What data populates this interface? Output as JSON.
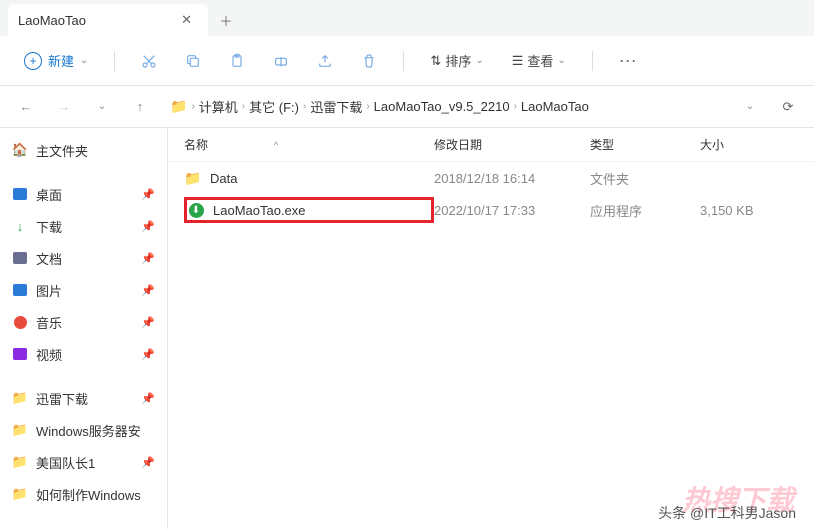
{
  "tab": {
    "title": "LaoMaoTao"
  },
  "toolbar": {
    "new_label": "新建",
    "sort_label": "排序",
    "view_label": "查看"
  },
  "breadcrumb": {
    "items": [
      "计算机",
      "其它 (F:)",
      "迅雷下载",
      "LaoMaoTao_v9.5_2210",
      "LaoMaoTao"
    ]
  },
  "sidebar": {
    "home_label": "主文件夹",
    "items": [
      {
        "label": "桌面",
        "color": "#2b7bd6"
      },
      {
        "label": "下载",
        "color": "#28a745",
        "arrow": true
      },
      {
        "label": "文档",
        "color": "#6a6f91"
      },
      {
        "label": "图片",
        "color": "#2b7bd6"
      },
      {
        "label": "音乐",
        "color": "#e84b3c",
        "circle": true
      },
      {
        "label": "视频",
        "color": "#8a2be2"
      }
    ],
    "folders": [
      {
        "label": "迅雷下载"
      },
      {
        "label": "Windows服务器安"
      },
      {
        "label": "美国队长1"
      },
      {
        "label": "如何制作Windows"
      }
    ]
  },
  "columns": {
    "name": "名称",
    "date": "修改日期",
    "type": "类型",
    "size": "大小"
  },
  "files": [
    {
      "name": "Data",
      "date": "2018/12/18 16:14",
      "type": "文件夹",
      "size": "",
      "icon": "folder"
    },
    {
      "name": "LaoMaoTao.exe",
      "date": "2022/10/17 17:33",
      "type": "应用程序",
      "size": "3,150 KB",
      "icon": "exe",
      "highlight": true
    }
  ],
  "watermark": "头条 @IT工科男Jason"
}
